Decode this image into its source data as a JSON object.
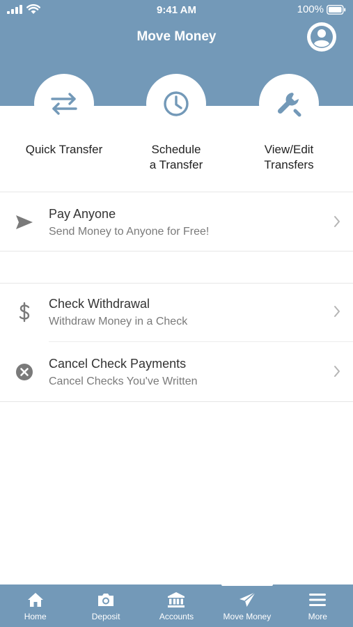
{
  "status_bar": {
    "time": "9:41 AM",
    "battery": "100%"
  },
  "header": {
    "title": "Move Money"
  },
  "quick_actions": [
    {
      "label": "Quick Transfer",
      "icon": "swap-arrows-icon"
    },
    {
      "label": "Schedule\na Transfer",
      "icon": "clock-icon"
    },
    {
      "label": "View/Edit\nTransfers",
      "icon": "wrench-icon"
    }
  ],
  "list": [
    {
      "title": "Pay Anyone",
      "subtitle": "Send Money to Anyone for Free!",
      "icon": "send-icon"
    },
    {
      "title": "Check Withdrawal",
      "subtitle": "Withdraw Money in a Check",
      "icon": "dollar-icon"
    },
    {
      "title": "Cancel Check Payments",
      "subtitle": "Cancel Checks You've Written",
      "icon": "cancel-circle-icon"
    }
  ],
  "tabs": [
    {
      "label": "Home",
      "icon": "home-icon"
    },
    {
      "label": "Deposit",
      "icon": "camera-icon"
    },
    {
      "label": "Accounts",
      "icon": "bank-icon"
    },
    {
      "label": "Move Money",
      "icon": "send-icon",
      "active": true
    },
    {
      "label": "More",
      "icon": "menu-icon"
    }
  ],
  "colors": {
    "brand": "#7399b8",
    "icon_gray": "#7a7a7a"
  }
}
